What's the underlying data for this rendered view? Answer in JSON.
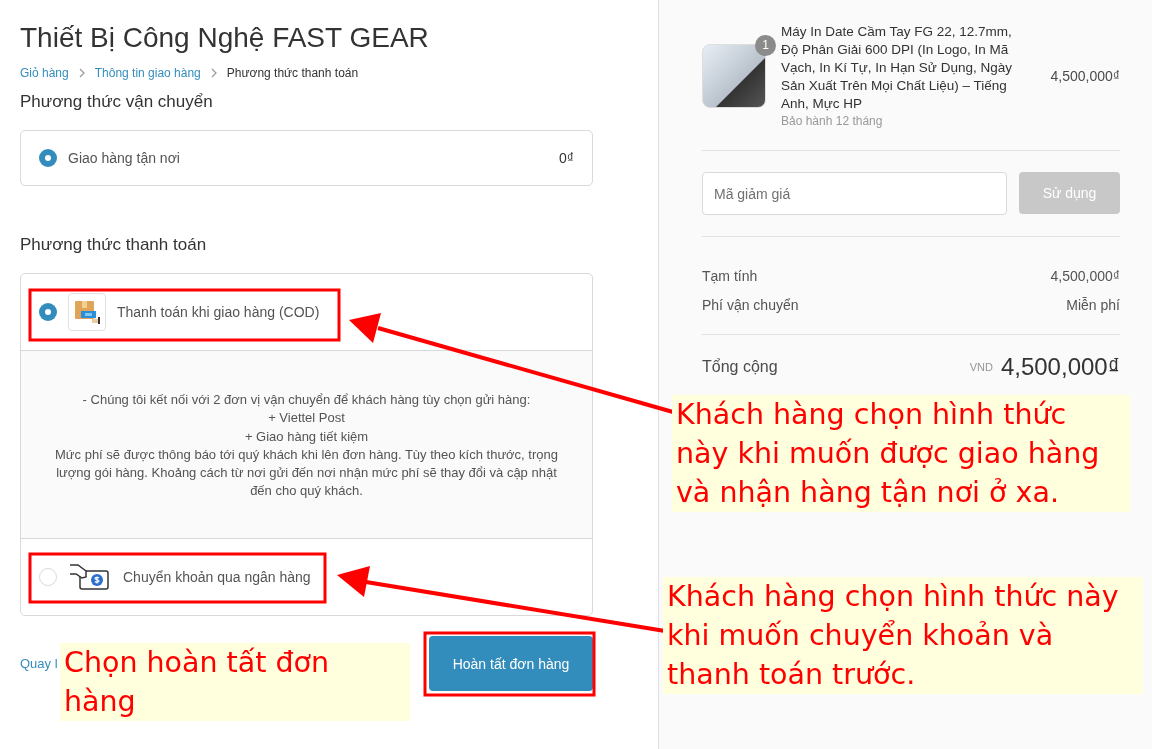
{
  "store_title": "Thiết Bị Công Nghệ FAST GEAR",
  "breadcrumb": [
    {
      "label": "Giỏ hàng",
      "selected": false
    },
    {
      "label": "Thông tin giao hàng",
      "selected": false
    },
    {
      "label": "Phương thức thanh toán",
      "selected": true
    }
  ],
  "shipping": {
    "heading": "Phương thức vận chuyển",
    "options": [
      {
        "label": "Giao hàng tận nơi",
        "price": "0₫",
        "selected": true
      }
    ]
  },
  "payment": {
    "heading": "Phương thức thanh toán",
    "options": [
      {
        "kind": "cod",
        "label": "Thanh toán khi giao hàng (COD)",
        "selected": true,
        "description": [
          "- Chúng tôi kết nối với 2 đơn vị vận chuyển để khách hàng tùy chọn gửi hàng:",
          "+ Viettel Post",
          "+ Giao hàng tiết kiệm",
          "Mức phí sẽ được thông báo tới quý khách khi lên đơn hàng. Tùy theo kích thước, trọng lượng gói hàng. Khoảng cách từ nơi gửi đến nơi nhận mức phí sẽ thay đổi và cập nhật đến cho quý khách."
        ]
      },
      {
        "kind": "bank",
        "label": "Chuyển khoản qua ngân hàng",
        "selected": false
      }
    ]
  },
  "back_link": "Quay l",
  "submit_button": "Hoàn tất đơn hàng",
  "order": {
    "items": [
      {
        "name": "Máy In Date Cầm Tay FG 22, 12.7mm, Độ Phân Giải 600 DPI (In Logo, In Mã Vạch, In Kí Tự, In Hạn Sử Dụng, Ngày Sản Xuất Trên Mọi Chất Liệu) – Tiếng Anh, Mực HP",
        "quantity": "1",
        "note": "Bảo hành 12 tháng",
        "price": "4,500,000₫"
      }
    ],
    "discount": {
      "placeholder": "Mã giảm giá",
      "button": "Sử dụng",
      "disabled": true
    },
    "lines": [
      {
        "label": "Tạm tính",
        "value": "4,500,000₫"
      },
      {
        "label": "Phí vận chuyển",
        "value": "Miễn phí"
      }
    ],
    "total": {
      "label": "Tổng cộng",
      "currency": "VND",
      "value": "4,500,000₫"
    }
  },
  "annotations": [
    {
      "text": "Khách hàng chọn hình thức này khi muốn được giao hàng và nhận hàng tận nơi ở xa."
    },
    {
      "text": "Khách hàng chọn hình thức này khi muốn chuyển khoản và thanh toán trước."
    },
    {
      "text": "Chọn hoàn tất đơn hàng"
    }
  ]
}
